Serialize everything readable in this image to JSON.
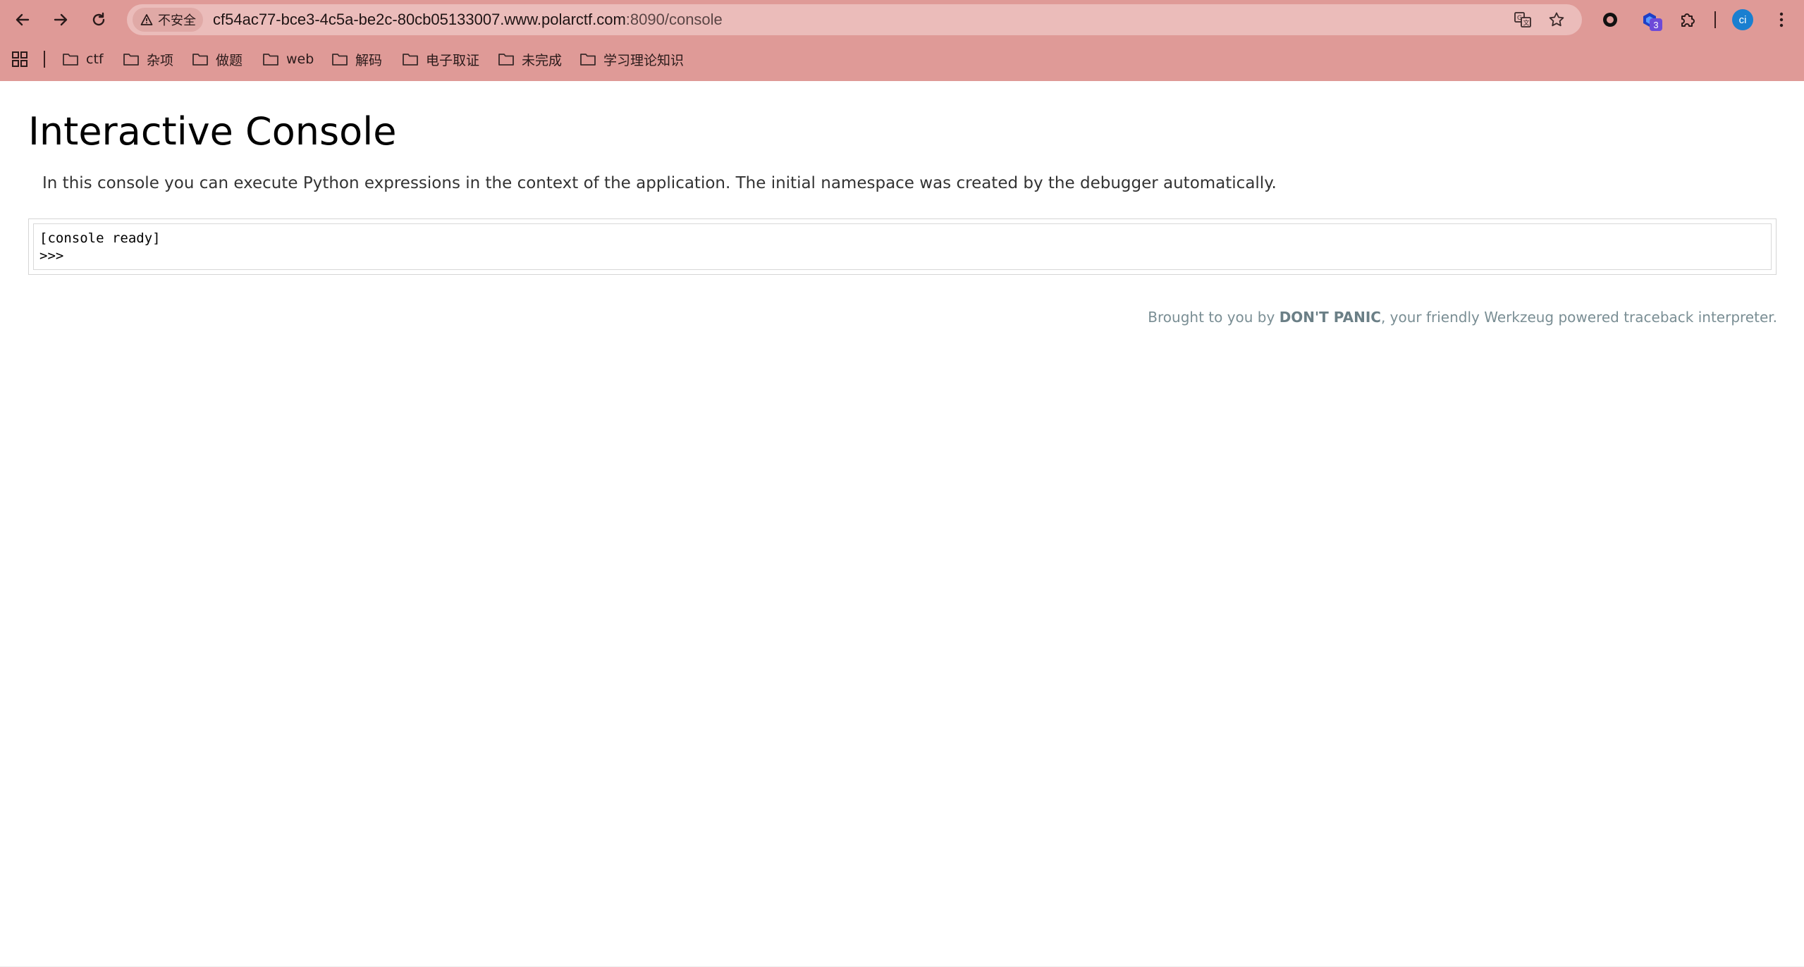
{
  "browser": {
    "security_label": "不安全",
    "url_host": "cf54ac77-bce3-4c5a-be2c-80cb05133007.www.polarctf.com",
    "url_path": ":8090/console",
    "extension_badge": "3",
    "profile_initials": "ci",
    "theme_color": "#df9a97"
  },
  "bookmarks": [
    {
      "label": "ctf"
    },
    {
      "label": "杂项"
    },
    {
      "label": "做题"
    },
    {
      "label": "web"
    },
    {
      "label": "解码"
    },
    {
      "label": "电子取证"
    },
    {
      "label": "未完成"
    },
    {
      "label": "学习理论知识"
    }
  ],
  "page": {
    "title": "Interactive Console",
    "explanation": "In this console you can execute Python expressions in the context of the application. The initial namespace was created by the debugger automatically.",
    "console": {
      "ready_line": "[console ready]",
      "prompt": ">>>"
    },
    "footer": {
      "prefix": "Brought to you by ",
      "brand": "DON'T PANIC",
      "suffix": ", your friendly Werkzeug powered traceback interpreter."
    }
  }
}
